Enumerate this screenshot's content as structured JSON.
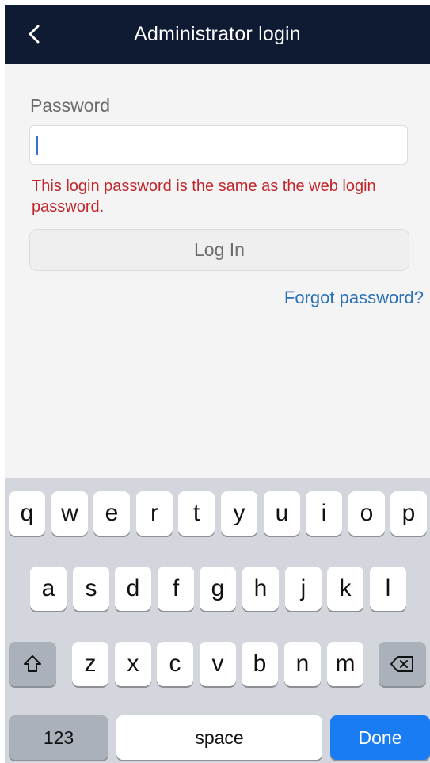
{
  "header": {
    "title": "Administrator login",
    "back_icon": "chevron-left-icon"
  },
  "form": {
    "password_label": "Password",
    "password_value": "",
    "hint": "This login password is the same as the web login password.",
    "login_label": "Log In",
    "forgot_label": "Forgot password?"
  },
  "keyboard": {
    "row1": [
      "q",
      "w",
      "e",
      "r",
      "t",
      "y",
      "u",
      "i",
      "o",
      "p"
    ],
    "row2": [
      "a",
      "s",
      "d",
      "f",
      "g",
      "h",
      "j",
      "k",
      "l"
    ],
    "row3": [
      "z",
      "x",
      "c",
      "v",
      "b",
      "n",
      "m"
    ],
    "shift_icon": "shift-icon",
    "delete_icon": "backspace-icon",
    "numbers_label": "123",
    "space_label": "space",
    "done_label": "Done"
  },
  "colors": {
    "header_bg": "#0f1b33",
    "hint": "#c0272d",
    "link": "#2a71b8",
    "done_key": "#1a7cf2"
  }
}
